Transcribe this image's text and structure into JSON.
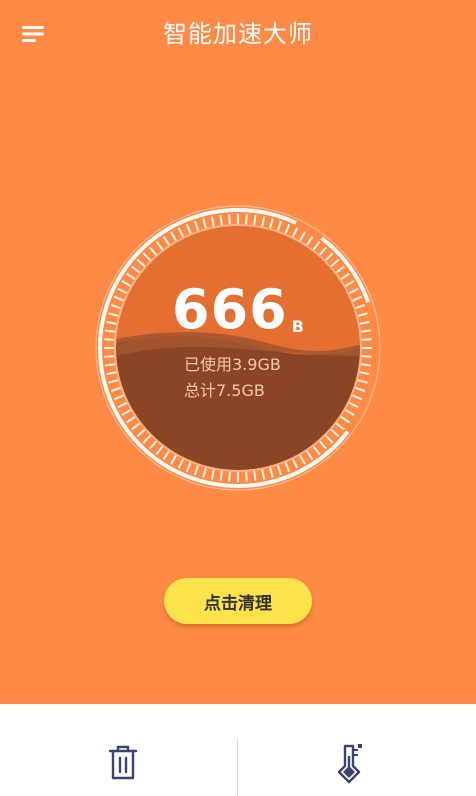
{
  "header": {
    "title": "智能加速大师",
    "menu_icon": "menu-icon"
  },
  "gauge": {
    "size_value": "666",
    "size_unit": "B",
    "used_text": "已使用3.9GB",
    "total_text": "总计7.5GB",
    "used_fraction": 0.52
  },
  "actions": {
    "clean_label": "点击清理"
  },
  "bottom_nav": {
    "items": [
      {
        "icon": "trash-icon"
      },
      {
        "icon": "thermometer-icon"
      }
    ]
  },
  "colors": {
    "background": "#FF8A45",
    "button": "#FCE34B",
    "liquid": "#8A4526",
    "text_muted": "#F6C8A5",
    "icon": "#3B4470"
  }
}
